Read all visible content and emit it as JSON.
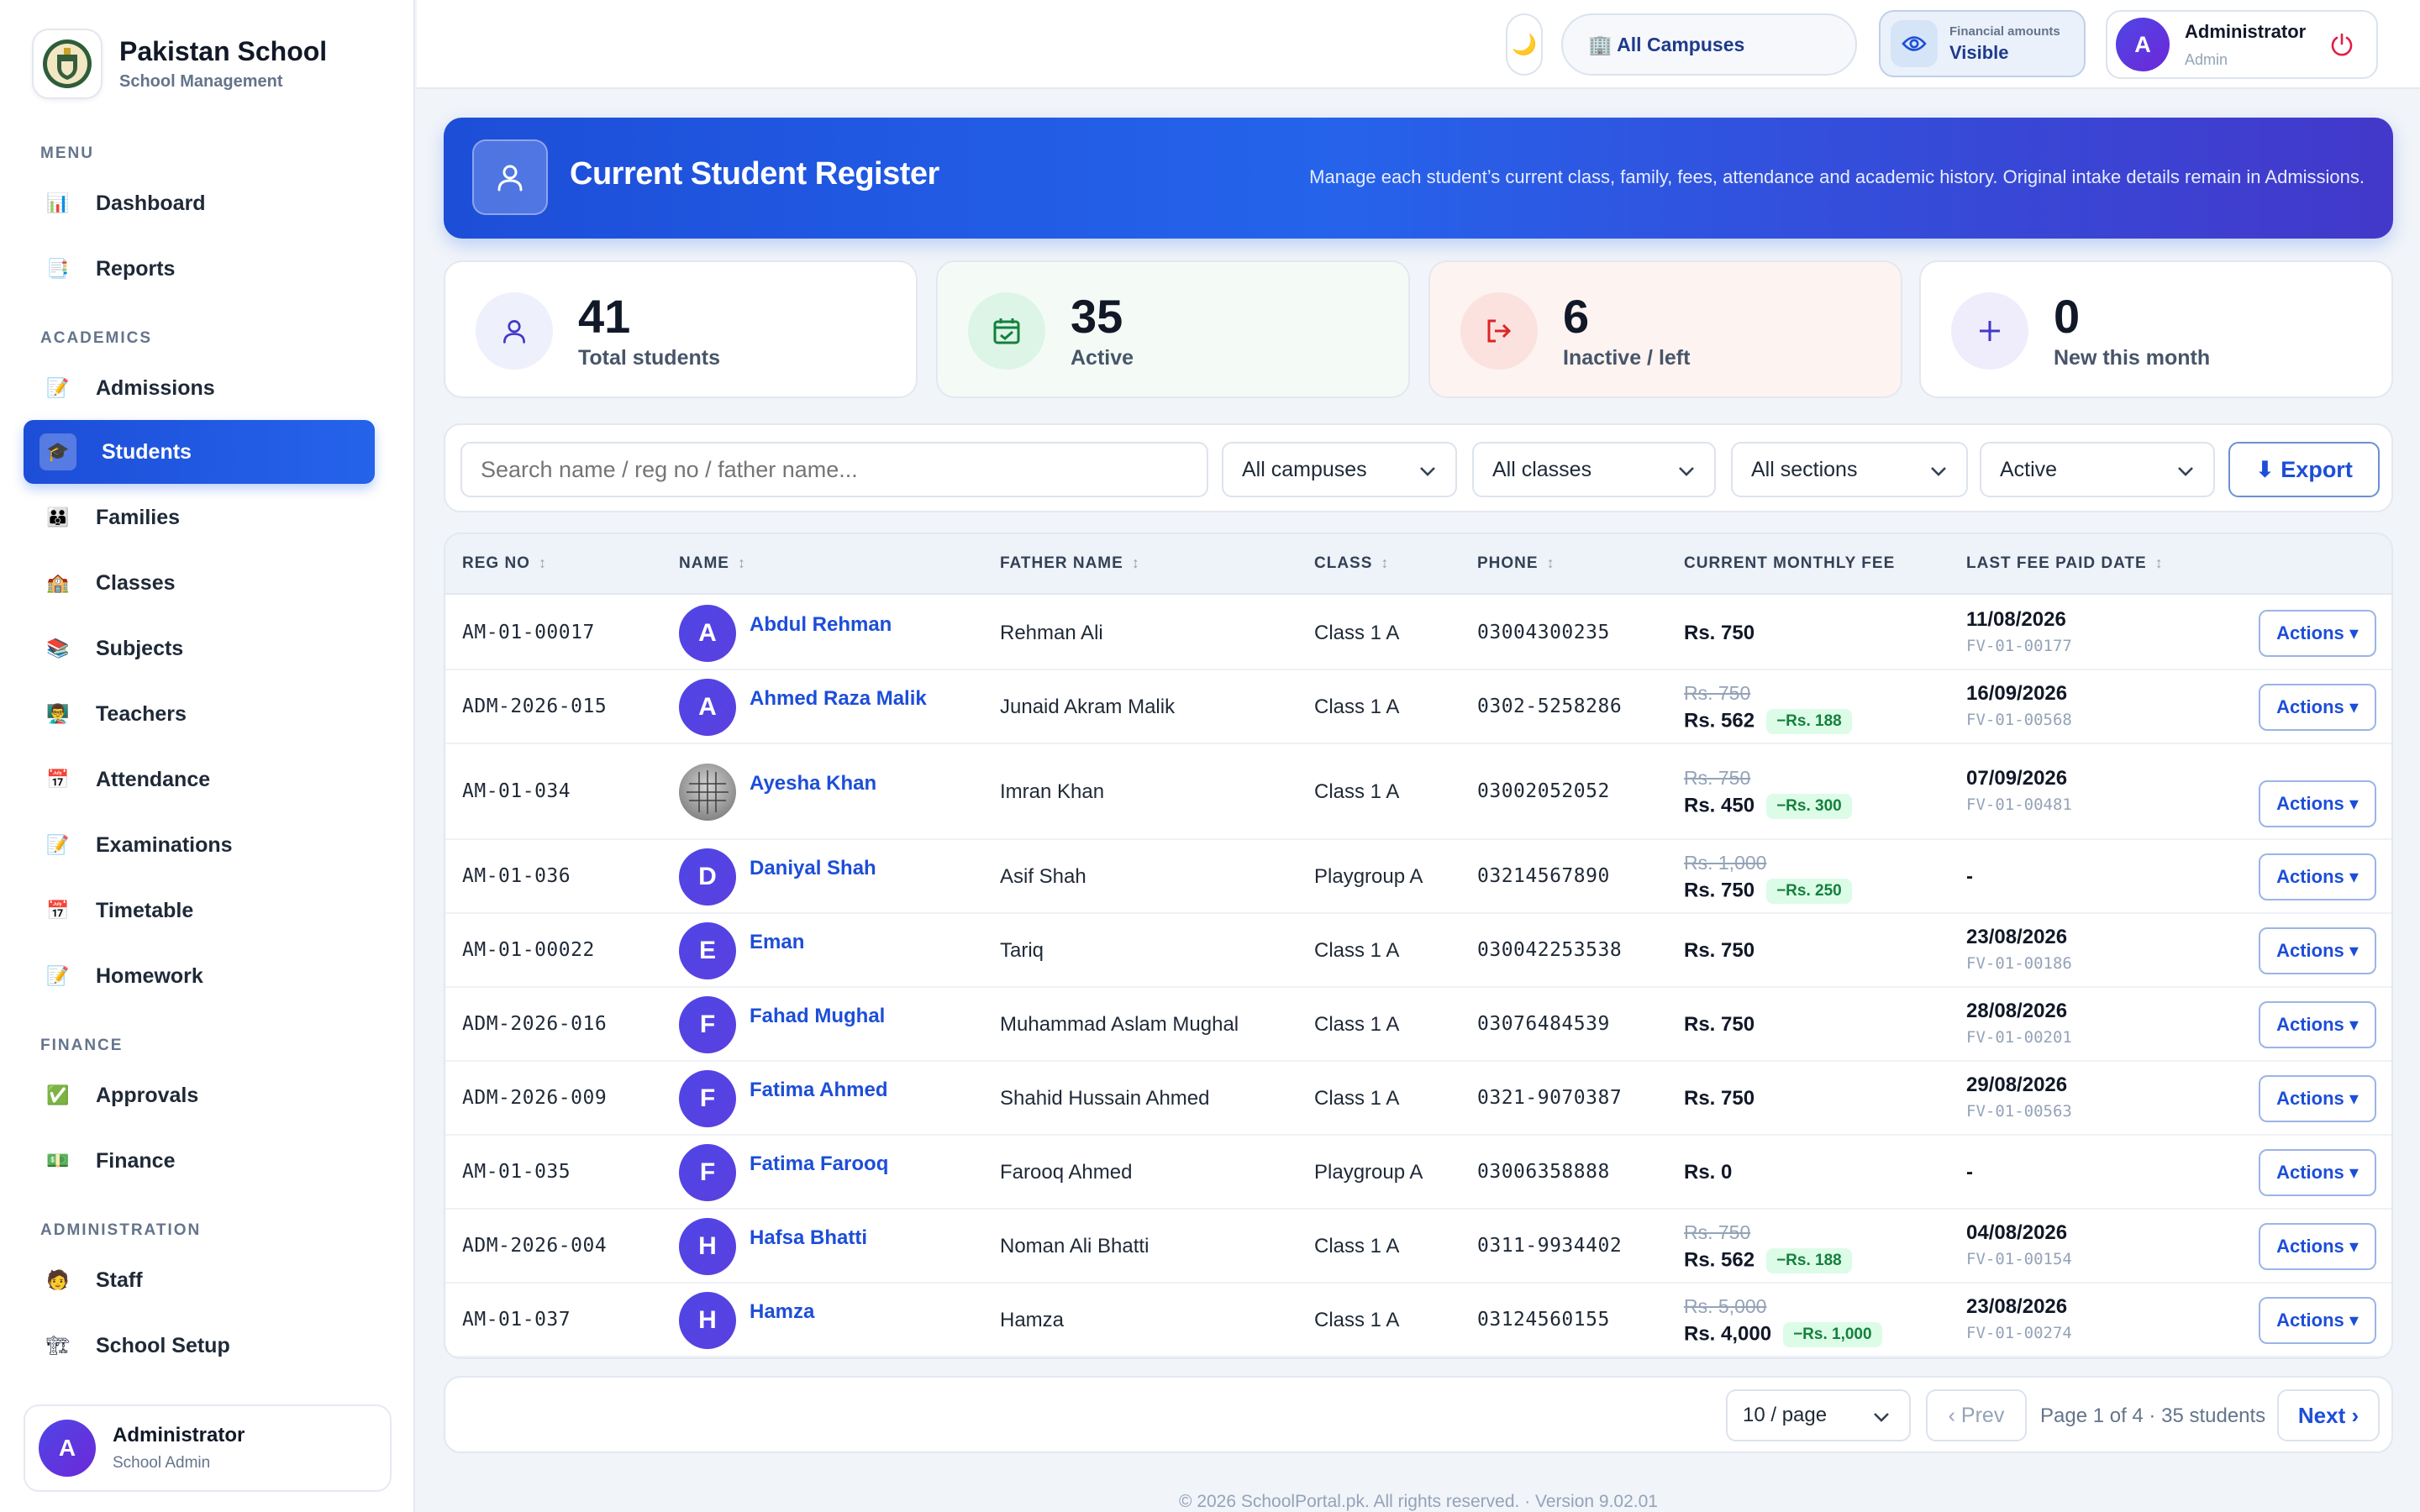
{
  "brand": {
    "name": "Pakistan School",
    "subtitle": "School Management"
  },
  "sidebar": {
    "sections": [
      "MENU",
      "ACADEMICS",
      "FINANCE",
      "ADMINISTRATION"
    ],
    "items": [
      {
        "label": "Dashboard",
        "icon": "bar-chart-icon"
      },
      {
        "label": "Reports",
        "icon": "report-icon"
      },
      {
        "label": "Admissions",
        "icon": "memo-icon"
      },
      {
        "label": "Students",
        "icon": "graduation-cap-icon",
        "active": true
      },
      {
        "label": "Families",
        "icon": "family-icon"
      },
      {
        "label": "Classes",
        "icon": "school-icon"
      },
      {
        "label": "Subjects",
        "icon": "books-icon"
      },
      {
        "label": "Teachers",
        "icon": "teacher-icon"
      },
      {
        "label": "Attendance",
        "icon": "calendar-icon"
      },
      {
        "label": "Examinations",
        "icon": "exam-icon"
      },
      {
        "label": "Timetable",
        "icon": "calendar-icon"
      },
      {
        "label": "Homework",
        "icon": "memo-icon"
      },
      {
        "label": "Approvals",
        "icon": "check-box-icon"
      },
      {
        "label": "Finance",
        "icon": "cash-icon"
      },
      {
        "label": "Staff",
        "icon": "person-icon"
      },
      {
        "label": "School Setup",
        "icon": "setup-icon"
      }
    ],
    "user": {
      "initial": "A",
      "name": "Administrator",
      "role": "School Admin"
    }
  },
  "topbar": {
    "campus": "🏢 All Campuses",
    "financial_caption": "Financial amounts",
    "financial_value": "Visible",
    "user": {
      "initial": "A",
      "name": "Administrator",
      "role": "Admin"
    }
  },
  "hero": {
    "title": "Current Student Register",
    "description": "Manage each student’s current class, family, fees, attendance and academic history. Original intake details remain in Admissions."
  },
  "stats": [
    {
      "value": "41",
      "label": "Total students"
    },
    {
      "value": "35",
      "label": "Active"
    },
    {
      "value": "6",
      "label": "Inactive / left"
    },
    {
      "value": "0",
      "label": "New this month"
    }
  ],
  "filters": {
    "search_placeholder": "Search name / reg no / father name...",
    "campus": "All campuses",
    "class": "All classes",
    "section": "All sections",
    "status": "Active",
    "export_label": "⬇ Export"
  },
  "table": {
    "headers": [
      "REG NO",
      "NAME",
      "FATHER NAME",
      "CLASS",
      "PHONE",
      "CURRENT MONTHLY FEE",
      "LAST FEE PAID DATE"
    ],
    "action_label": "Actions ▾",
    "rows": [
      {
        "reg": "AM-01-00017",
        "initial": "A",
        "name": "Abdul Rehman",
        "father": "Rehman Ali",
        "class": "Class 1 A",
        "phone": "03004300235",
        "old_fee": "",
        "fee": "Rs. 750",
        "discount": "",
        "paid": "11/08/2026",
        "voucher": "FV-01-00177"
      },
      {
        "reg": "ADM-2026-015",
        "initial": "A",
        "name": "Ahmed Raza Malik",
        "father": "Junaid Akram Malik",
        "class": "Class 1 A",
        "phone": "0302-5258286",
        "old_fee": "Rs. 750",
        "fee": "Rs. 562",
        "discount": "−Rs. 188",
        "paid": "16/09/2026",
        "voucher": "FV-01-00568"
      },
      {
        "reg": "AM-01-034",
        "initial": "",
        "name": "Ayesha Khan",
        "father": "Imran Khan",
        "class": "Class 1 A",
        "phone": "03002052052",
        "old_fee": "Rs. 750",
        "fee": "Rs. 450",
        "discount": "−Rs. 300",
        "paid": "07/09/2026",
        "voucher": "FV-01-00481"
      },
      {
        "reg": "AM-01-036",
        "initial": "D",
        "name": "Daniyal Shah",
        "father": "Asif Shah",
        "class": "Playgroup A",
        "phone": "03214567890",
        "old_fee": "Rs. 1,000",
        "fee": "Rs. 750",
        "discount": "−Rs. 250",
        "paid": "-",
        "voucher": ""
      },
      {
        "reg": "AM-01-00022",
        "initial": "E",
        "name": "Eman",
        "father": "Tariq",
        "class": "Class 1 A",
        "phone": "030042253538",
        "old_fee": "",
        "fee": "Rs. 750",
        "discount": "",
        "paid": "23/08/2026",
        "voucher": "FV-01-00186"
      },
      {
        "reg": "ADM-2026-016",
        "initial": "F",
        "name": "Fahad Mughal",
        "father": "Muhammad Aslam Mughal",
        "class": "Class 1 A",
        "phone": "03076484539",
        "old_fee": "",
        "fee": "Rs. 750",
        "discount": "",
        "paid": "28/08/2026",
        "voucher": "FV-01-00201"
      },
      {
        "reg": "ADM-2026-009",
        "initial": "F",
        "name": "Fatima Ahmed",
        "father": "Shahid Hussain Ahmed",
        "class": "Class 1 A",
        "phone": "0321-9070387",
        "old_fee": "",
        "fee": "Rs. 750",
        "discount": "",
        "paid": "29/08/2026",
        "voucher": "FV-01-00563"
      },
      {
        "reg": "AM-01-035",
        "initial": "F",
        "name": "Fatima Farooq",
        "father": "Farooq Ahmed",
        "class": "Playgroup A",
        "phone": "03006358888",
        "old_fee": "",
        "fee": "Rs. 0",
        "discount": "",
        "paid": "-",
        "voucher": ""
      },
      {
        "reg": "ADM-2026-004",
        "initial": "H",
        "name": "Hafsa Bhatti",
        "father": "Noman Ali Bhatti",
        "class": "Class 1 A",
        "phone": "0311-9934402",
        "old_fee": "Rs. 750",
        "fee": "Rs. 562",
        "discount": "−Rs. 188",
        "paid": "04/08/2026",
        "voucher": "FV-01-00154"
      },
      {
        "reg": "AM-01-037",
        "initial": "H",
        "name": "Hamza",
        "father": "Hamza",
        "class": "Class 1 A",
        "phone": "03124560155",
        "old_fee": "Rs. 5,000",
        "fee": "Rs. 4,000",
        "discount": "−Rs. 1,000",
        "paid": "23/08/2026",
        "voucher": "FV-01-00274"
      }
    ]
  },
  "pagination": {
    "per_page": "10 / page",
    "prev": "‹ Prev",
    "info": "Page 1 of 4 · 35 students",
    "next": "Next ›"
  },
  "footer": "© 2026 SchoolPortal.pk. All rights reserved. · Version 9.02.01",
  "colors": {
    "primary": "#2563eb",
    "accent": "#4f46e5",
    "success": "#15803d"
  }
}
